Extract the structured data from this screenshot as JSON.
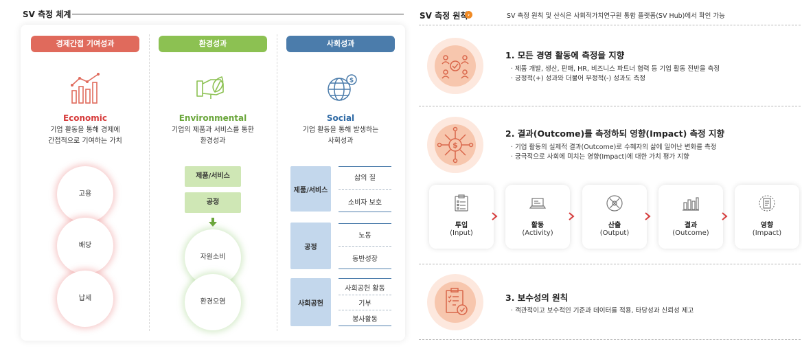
{
  "left": {
    "title": "SV 측정 체계",
    "columns": [
      {
        "pill": "경제간접 기여성과",
        "heading": "Economic",
        "desc": [
          "기업 활동을 통해 경제에",
          "간접적으로 기여하는 가치"
        ],
        "icon": "bar-chart-icon",
        "circles": [
          "고용",
          "배당",
          "납세"
        ]
      },
      {
        "pill": "환경성과",
        "heading": "Environmental",
        "desc": [
          "기업의 제품과 서비스를 통한",
          "환경성과"
        ],
        "icon": "hand-leaf-icon",
        "boxes": [
          "제품/서비스",
          "공정"
        ],
        "circles": [
          "자원소비",
          "환경오염"
        ]
      },
      {
        "pill": "사회성과",
        "heading": "Social",
        "desc": [
          "기업 활동을 통해 발생하는",
          "사회성과"
        ],
        "icon": "globe-dollar-icon",
        "groups": [
          {
            "label": "제품/서비스",
            "items": [
              "삶의 질",
              "소비자 보호"
            ]
          },
          {
            "label": "공정",
            "items": [
              "노동",
              "동반성장"
            ]
          },
          {
            "label": "사회공헌",
            "items": [
              "사회공헌 활동",
              "기부",
              "봉사활동"
            ]
          }
        ]
      }
    ]
  },
  "right": {
    "title": "SV 측정 원칙",
    "note": "SV 측정 원칙 및 산식은 사회적가치연구원 통합 플랫폼(SV Hub)에서 확인 가능",
    "principles": [
      {
        "title": "1. 모든 경영 활동에 측정을 지향",
        "bullets": [
          "· 제품 개발, 생산, 판매, HR, 비즈니스 파트너 협력 등 기업 활동 전반을 측정",
          "· 긍정적(+) 성과와 더불어 부정적(-) 성과도 측정"
        ],
        "icon": "people-network-icon"
      },
      {
        "title": "2. 결과(Outcome)를 측정하되 영향(Impact) 측정 지향",
        "bullets": [
          "· 기업 활동의 실제적 결과(Outcome)로 수혜자의 삶에 일어난 변화를 측정",
          "· 궁극적으로 사회에 미치는 영향(Impact)에 대한 가치 평가 지향"
        ],
        "icon": "dollar-network-icon"
      },
      {
        "title": "3. 보수성의 원칙",
        "bullets": [
          "· 객관적이고 보수적인 기준과 데이터를 적용, 타당성과 신뢰성 제고"
        ],
        "icon": "clipboard-check-icon"
      }
    ],
    "flow": [
      {
        "label": "투입",
        "sub": "(Input)",
        "icon": "checklist-icon"
      },
      {
        "label": "활동",
        "sub": "(Activity)",
        "icon": "laptop-icon"
      },
      {
        "label": "산출",
        "sub": "(Output)",
        "icon": "tools-icon"
      },
      {
        "label": "결과",
        "sub": "(Outcome)",
        "icon": "bar-chart-icon"
      },
      {
        "label": "영향",
        "sub": "(Impact)",
        "icon": "document-target-icon"
      }
    ]
  },
  "colors": {
    "economic": "#e06a5c",
    "environmental": "#8cc152",
    "social": "#4b7cab",
    "accent": "#f08a24",
    "peach": "#f7c6ad"
  }
}
